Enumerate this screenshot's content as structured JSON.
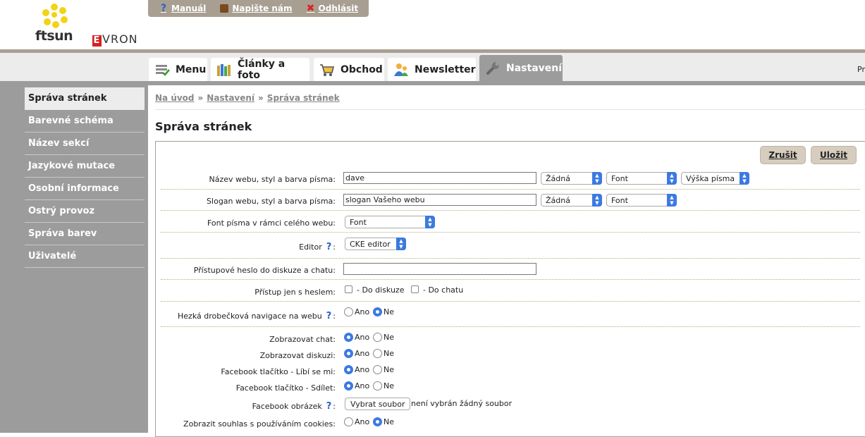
{
  "brand": {
    "ftsun": "ftsun",
    "evron_e": "E",
    "evron_rest": "VRON"
  },
  "topbar": {
    "manual": "Manuál",
    "write": "Napište nám",
    "logout": "Odhlásit"
  },
  "tabs": [
    {
      "label": "Menu",
      "icon": "menu-list-icon"
    },
    {
      "label": "Články a foto",
      "icon": "articles-photo-icon"
    },
    {
      "label": "Obchod",
      "icon": "shopping-cart-icon"
    },
    {
      "label": "Newsletter",
      "icon": "newsletter-users-icon"
    },
    {
      "label": "Nastavení",
      "icon": "wrench-icon",
      "active": true
    }
  ],
  "header_right_text": "Pr",
  "sidebar": {
    "items": [
      {
        "label": "Správa stránek",
        "active": true
      },
      {
        "label": "Barevné schéma"
      },
      {
        "label": "Název sekcí"
      },
      {
        "label": "Jazykové mutace"
      },
      {
        "label": "Osobní informace"
      },
      {
        "label": "Ostrý provoz"
      },
      {
        "label": "Správa barev"
      },
      {
        "label": "Uživatelé"
      }
    ]
  },
  "breadcrumb": {
    "home": "Na úvod",
    "settings": "Nastavení",
    "current": "Správa stránek",
    "separator": "»"
  },
  "page_title": "Správa stránek",
  "buttons": {
    "cancel": "Zrušit",
    "save": "Uložit"
  },
  "form": {
    "site_name": {
      "label": "Název webu, styl a barva písma:",
      "value": "dave",
      "style": "Žádná",
      "font": "Font",
      "size": "Výška písma"
    },
    "slogan": {
      "label": "Slogan webu, styl a barva písma:",
      "value": "slogan Vašeho webu",
      "style": "Žádná",
      "font": "Font"
    },
    "global_font": {
      "label": "Font písma v rámci celého webu:",
      "value": "Font"
    },
    "editor": {
      "label": "Editor",
      "value": "CKE editor"
    },
    "password": {
      "label": "Přístupové heslo do diskuze a chatu:",
      "value": ""
    },
    "access": {
      "label": "Přístup jen s heslem:",
      "opt1": "- Do diskuze",
      "opt2": "- Do chatu"
    },
    "breadcrumb_nav": {
      "label": "Hezká drobečková navigace na webu",
      "selected": "Ne"
    },
    "chat": {
      "label": "Zobrazovat chat:",
      "selected": "Ano"
    },
    "discussion": {
      "label": "Zobrazovat diskuzi:",
      "selected": "Ano"
    },
    "fb_like": {
      "label": "Facebook tlačítko - Líbí se mi:",
      "selected": "Ano"
    },
    "fb_share": {
      "label": "Facebook tlačítko - Sdílet:",
      "selected": "Ano"
    },
    "fb_image": {
      "label": "Facebook obrázek",
      "button": "Vybrat soubor",
      "status": "není vybrán žádný soubor"
    },
    "cookies": {
      "label": "Zobrazit souhlas s používáním cookies:",
      "selected": "Ne"
    },
    "yes": "Ano",
    "no": "Ne",
    "help": "?"
  }
}
